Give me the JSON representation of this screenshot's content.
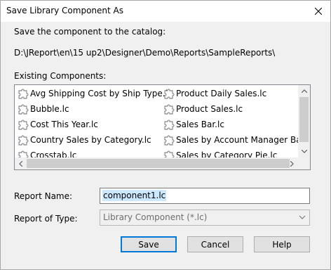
{
  "window": {
    "title": "Save Library Component As"
  },
  "dialog": {
    "instruction": "Save the component to the catalog:",
    "path": "D:\\JReport\\en\\15 up2\\Designer\\Demo\\Reports\\SampleReports\\",
    "existing_label": "Existing Components:",
    "components_left": [
      "Avg Shipping Cost by Ship Type.lc",
      "Bubble.lc",
      "Cost This Year.lc",
      "Country Sales by Category.lc",
      "Crosstab.lc"
    ],
    "components_right": [
      "Product Daily Sales.lc",
      "Product Sales.lc",
      "Sales Bar.lc",
      "Sales by Account Manager Bar.lc",
      "Sales by Category Pie.lc"
    ],
    "report_name_label": "Report Name:",
    "report_name_value": "component1.lc",
    "report_type_label": "Report of Type:",
    "report_type_value": "Library Component (*.lc)"
  },
  "buttons": {
    "save": "Save",
    "cancel": "Cancel",
    "help": "Help"
  },
  "colors": {
    "accent": "#0078d7",
    "selection": "#cce8ff"
  },
  "icons": {
    "component": "puzzle-piece-icon",
    "close": "close-icon"
  }
}
